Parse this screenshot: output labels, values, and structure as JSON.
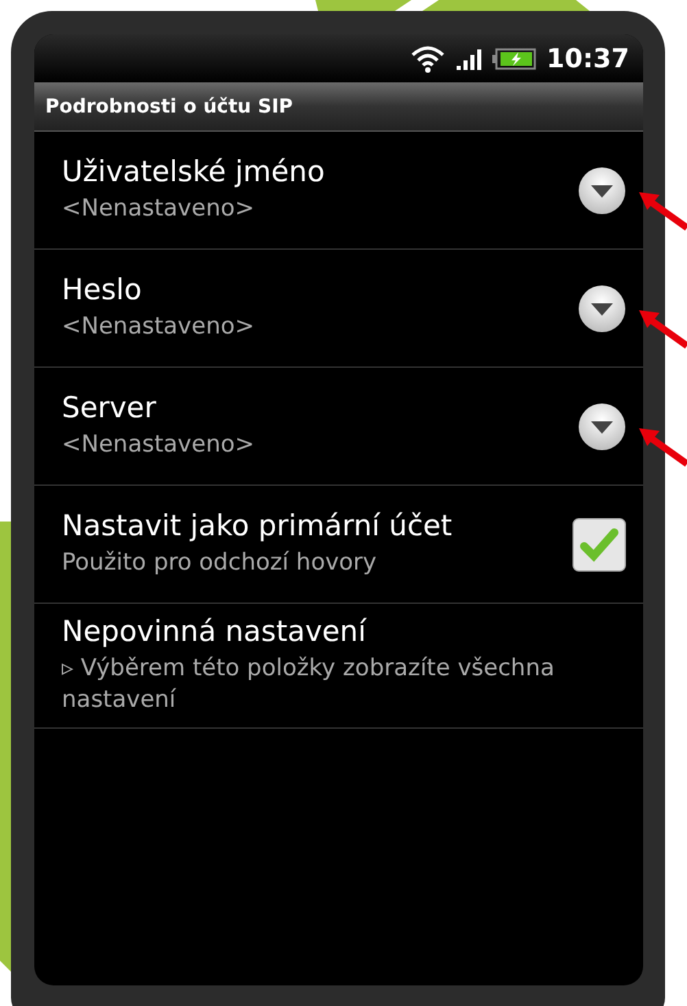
{
  "status_bar": {
    "time": "10:37"
  },
  "title_bar": {
    "title": "Podrobnosti o účtu SIP"
  },
  "settings": [
    {
      "kind": "dropdown",
      "title": "Uživatelské jméno",
      "summary": "<Nenastaveno>",
      "annotated": true
    },
    {
      "kind": "dropdown",
      "title": "Heslo",
      "summary": "<Nenastaveno>",
      "annotated": true
    },
    {
      "kind": "dropdown",
      "title": "Server",
      "summary": "<Nenastaveno>",
      "annotated": true
    },
    {
      "kind": "checkbox",
      "title": "Nastavit jako primární účet",
      "summary": "Použito pro odchozí hovory",
      "checked": true
    },
    {
      "kind": "link",
      "title": "Nepovinná nastavení",
      "summary": "▹ Výběrem této položky zobrazíte všechna nastavení"
    }
  ]
}
